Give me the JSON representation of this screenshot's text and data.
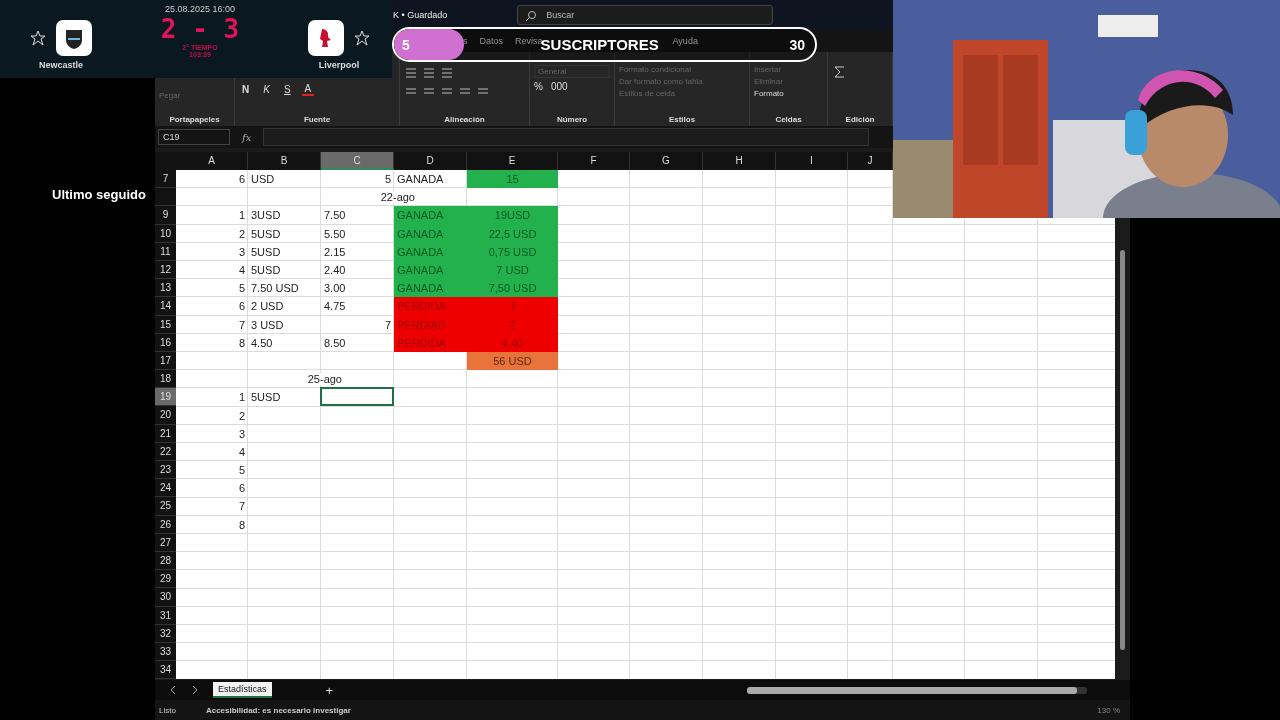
{
  "title_bar": {
    "title": "K • Guardado",
    "search": {
      "placeholder": "Buscar"
    }
  },
  "ribbon_tabs": [
    {
      "label": "s",
      "selected": false
    },
    {
      "label": "Datos",
      "selected": false
    },
    {
      "label": "Revisa",
      "selected": false
    },
    {
      "label": "Ayuda",
      "selected": false
    }
  ],
  "ribbon_groups": [
    {
      "label": "Portapapeles",
      "items": [
        {
          "kind": "big",
          "text": "Pegar",
          "disabled": true
        }
      ]
    },
    {
      "label": "Fuente",
      "items": [
        {
          "kind": "bold",
          "text": "N",
          "disabled": false
        },
        {
          "kind": "italic",
          "text": "K",
          "disabled": false
        },
        {
          "kind": "underline",
          "text": "S",
          "disabled": false
        },
        {
          "kind": "fontcolor",
          "text": "A",
          "disabled": false
        }
      ]
    },
    {
      "label": "Alineación"
    },
    {
      "label": "Número",
      "items": [
        {
          "kind": "combo",
          "text": "General",
          "disabled": true
        },
        {
          "kind": "small",
          "text": "%",
          "disabled": false
        },
        {
          "kind": "small",
          "text": "000",
          "disabled": false
        }
      ]
    },
    {
      "label": "Estilos",
      "items": [
        {
          "kind": "row",
          "text": "Formato condicional",
          "disabled": true
        },
        {
          "kind": "row",
          "text": "Dar formato como tabla",
          "disabled": true
        },
        {
          "kind": "row",
          "text": "Estilos de celda",
          "disabled": true
        }
      ]
    },
    {
      "label": "Celdas",
      "items": [
        {
          "kind": "row",
          "text": "Insertar",
          "disabled": true
        },
        {
          "kind": "row",
          "text": "Eliminar",
          "disabled": true
        },
        {
          "kind": "row",
          "text": "Formato",
          "disabled": false
        }
      ]
    },
    {
      "label": "Edición"
    }
  ],
  "formula_bar": {
    "name_box": "C19",
    "fx": "fx"
  },
  "columns": [
    {
      "label": "A",
      "selected": false
    },
    {
      "label": "B",
      "selected": false
    },
    {
      "label": "C",
      "selected": true
    },
    {
      "label": "D",
      "selected": false
    },
    {
      "label": "E",
      "selected": false
    },
    {
      "label": "F",
      "selected": false
    },
    {
      "label": "G",
      "selected": false
    },
    {
      "label": "H",
      "selected": false
    },
    {
      "label": "I",
      "selected": false
    },
    {
      "label": "J",
      "selected": false
    }
  ],
  "rows": [
    {
      "number": "7",
      "selected": false,
      "cells": [
        {
          "text": "6",
          "kind": "number"
        },
        {
          "text": "USD",
          "kind": "text"
        },
        {
          "text": "5",
          "kind": "number"
        },
        {
          "text": "GANADA",
          "kind": "text"
        },
        {
          "text": "15",
          "kind": "center",
          "color": "#22b14c"
        }
      ]
    },
    {
      "selected": false,
      "cells": [
        null,
        null,
        {
          "text": "22-ago",
          "kind": "overflow"
        },
        null,
        null
      ]
    },
    {
      "number": "9",
      "selected": false,
      "cells": [
        {
          "text": "1",
          "kind": "number"
        },
        {
          "text": "3USD",
          "kind": "text"
        },
        {
          "text": "7.50",
          "kind": "text"
        },
        {
          "text": "GANADA",
          "kind": "text",
          "color": "#22b14c"
        },
        {
          "text": "19USD",
          "kind": "center",
          "color": "#22b14c"
        }
      ]
    },
    {
      "number": "10",
      "selected": false,
      "cells": [
        {
          "text": "2",
          "kind": "number"
        },
        {
          "text": "5USD",
          "kind": "text"
        },
        {
          "text": "5.50",
          "kind": "text"
        },
        {
          "text": "GANADA",
          "kind": "text",
          "color": "#22b14c"
        },
        {
          "text": "22,5 USD",
          "kind": "center",
          "color": "#22b14c"
        }
      ]
    },
    {
      "number": "11",
      "selected": false,
      "cells": [
        {
          "text": "3",
          "kind": "number"
        },
        {
          "text": "5USD",
          "kind": "text"
        },
        {
          "text": "2.15",
          "kind": "text"
        },
        {
          "text": "GANADA",
          "kind": "text",
          "color": "#22b14c"
        },
        {
          "text": "0,75 USD",
          "kind": "center",
          "color": "#22b14c"
        }
      ]
    },
    {
      "number": "12",
      "selected": false,
      "cells": [
        {
          "text": "4",
          "kind": "number"
        },
        {
          "text": "5USD",
          "kind": "text"
        },
        {
          "text": "2.40",
          "kind": "text"
        },
        {
          "text": "GANADA",
          "kind": "text",
          "color": "#22b14c"
        },
        {
          "text": "7 USD",
          "kind": "center",
          "color": "#22b14c"
        }
      ]
    },
    {
      "number": "13",
      "selected": false,
      "cells": [
        {
          "text": "5",
          "kind": "number"
        },
        {
          "text": "7.50 USD",
          "kind": "text"
        },
        {
          "text": "3.00",
          "kind": "text"
        },
        {
          "text": "GANADA",
          "kind": "text",
          "color": "#22b14c"
        },
        {
          "text": "7,50 USD",
          "kind": "center",
          "color": "#22b14c"
        }
      ]
    },
    {
      "number": "14",
      "selected": false,
      "cells": [
        {
          "text": "6",
          "kind": "number"
        },
        {
          "text": "2 USD",
          "kind": "text"
        },
        {
          "text": "4.75",
          "kind": "text"
        },
        {
          "text": "PERDIDA",
          "kind": "text",
          "color": "#ee0000"
        },
        {
          "text": "1",
          "kind": "center",
          "color": "#ee0000"
        }
      ]
    },
    {
      "number": "15",
      "selected": false,
      "cells": [
        {
          "text": "7",
          "kind": "number"
        },
        {
          "text": "3 USD",
          "kind": "text"
        },
        {
          "text": "7",
          "kind": "number"
        },
        {
          "text": "PERDIAD",
          "kind": "text",
          "color": "#ee0000"
        },
        {
          "text": "2",
          "kind": "center",
          "color": "#ee0000"
        }
      ]
    },
    {
      "number": "16",
      "selected": false,
      "cells": [
        {
          "text": "8",
          "kind": "number"
        },
        {
          "text": "4.50",
          "kind": "text"
        },
        {
          "text": "8.50",
          "kind": "text"
        },
        {
          "text": "PERDIDA",
          "kind": "text",
          "color": "#ee0000"
        },
        {
          "text": "4.40",
          "kind": "center",
          "color": "#ee0000"
        }
      ]
    },
    {
      "number": "17",
      "selected": false,
      "cells": [
        null,
        null,
        null,
        null,
        {
          "text": "56 USD",
          "kind": "center",
          "color": "#e8743b"
        }
      ]
    },
    {
      "number": "18",
      "selected": false,
      "cells": [
        null,
        {
          "text": "25-ago",
          "kind": "overflow"
        },
        null,
        null,
        null
      ]
    },
    {
      "number": "19",
      "selected": true,
      "cells": [
        {
          "text": "1",
          "kind": "number"
        },
        {
          "text": "5USD",
          "kind": "text"
        },
        {
          "selected": true
        },
        null,
        null
      ]
    },
    {
      "number": "20",
      "selected": false,
      "cells": [
        {
          "text": "2",
          "kind": "number"
        },
        null,
        null,
        null,
        null
      ]
    },
    {
      "number": "21",
      "selected": false,
      "cells": [
        {
          "text": "3",
          "kind": "number"
        },
        null,
        null,
        null,
        null
      ]
    },
    {
      "number": "22",
      "selected": false,
      "cells": [
        {
          "text": "4",
          "kind": "number"
        },
        null,
        null,
        null,
        null
      ]
    },
    {
      "number": "23",
      "selected": false,
      "cells": [
        {
          "text": "5",
          "kind": "number"
        },
        null,
        null,
        null,
        null
      ]
    },
    {
      "number": "24",
      "selected": false,
      "cells": [
        {
          "text": "6",
          "kind": "number"
        },
        null,
        null,
        null,
        null
      ]
    },
    {
      "number": "25",
      "selected": false,
      "cells": [
        {
          "text": "7",
          "kind": "number"
        },
        null,
        null,
        null,
        null
      ]
    },
    {
      "number": "26",
      "selected": false,
      "cells": [
        {
          "text": "8",
          "kind": "number"
        },
        null,
        null,
        null,
        null
      ]
    },
    {
      "number": "27",
      "selected": false,
      "cells": []
    },
    {
      "number": "28",
      "selected": false,
      "cells": []
    },
    {
      "number": "29",
      "selected": false,
      "cells": []
    },
    {
      "number": "30",
      "selected": false,
      "cells": []
    },
    {
      "number": "31",
      "selected": false,
      "cells": []
    },
    {
      "number": "32",
      "selected": false,
      "cells": []
    },
    {
      "number": "33",
      "selected": false,
      "cells": []
    },
    {
      "number": "34",
      "selected": false,
      "cells": []
    }
  ],
  "sheet_tabs": [
    {
      "label": "Estadísticas",
      "selected": true
    }
  ],
  "add_sheet": "+",
  "status_bar": {
    "state": "Listo",
    "accessibility": "Accesibilidad: es necesario investigar",
    "zoom": "130 %"
  },
  "scoreboard": {
    "date": "25.08.2025 16:00",
    "score": "2 - 3",
    "period": "2° TIEMPO",
    "clock": "103:39",
    "teams": [
      {
        "name": "Newcastle",
        "favorite": false
      },
      {
        "name": "Liverpool",
        "favorite": false
      }
    ]
  },
  "subscriber_goal": {
    "current": "5",
    "label": "SUSCRIPTORES",
    "target": "30",
    "level": 0.167
  },
  "last_follower": {
    "label": "Ultimo seguido"
  }
}
